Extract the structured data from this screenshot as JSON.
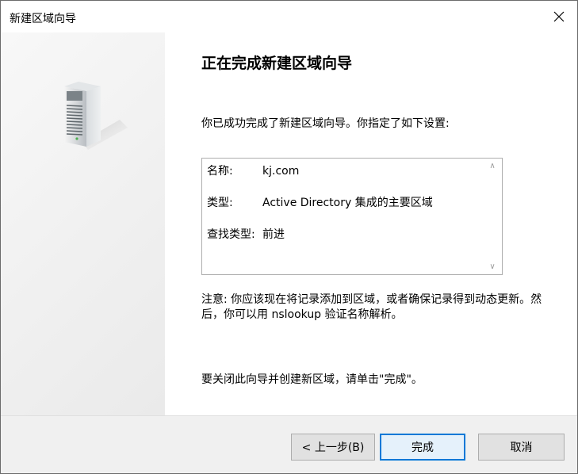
{
  "window": {
    "title": "新建区域向导"
  },
  "main": {
    "heading": "正在完成新建区域向导",
    "intro": "你已成功完成了新建区域向导。你指定了如下设置:",
    "summary": [
      {
        "label": "名称:",
        "value": "kj.com"
      },
      {
        "label": "类型:",
        "value": "Active Directory 集成的主要区域"
      },
      {
        "label": "查找类型:",
        "value": "前进"
      }
    ],
    "note": "注意: 你应该现在将记录添加到区域，或者确保记录得到动态更新。然后，你可以用 nslookup 验证名称解析。",
    "finish_text": "要关闭此向导并创建新区域，请单击\"完成\"。"
  },
  "buttons": {
    "back": "< 上一步(B)",
    "finish": "完成",
    "cancel": "取消"
  },
  "icons": {
    "close": "close-icon",
    "server": "server-icon",
    "scroll_up": "chevron-up-icon",
    "scroll_down": "chevron-down-icon"
  },
  "colors": {
    "accent": "#0078d7",
    "footer_bg": "#f0f0f0"
  }
}
